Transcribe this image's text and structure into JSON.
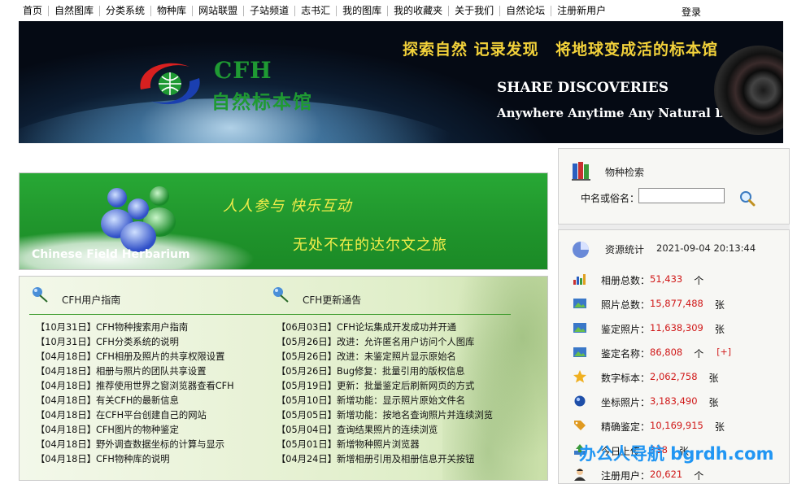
{
  "nav": {
    "items": [
      "首页",
      "自然图库",
      "分类系统",
      "物种库",
      "网站联盟",
      "子站频道",
      "志书汇",
      "我的图库",
      "我的收藏夹",
      "关于我们",
      "自然论坛",
      "注册新用户"
    ],
    "login": "登录"
  },
  "banner": {
    "cfh": "CFH",
    "name": "自然标本馆",
    "slogan1": "探索自然 记录发现",
    "slogan2": "将地球变成活的标本馆",
    "share": "SHARE DISCOVERIES",
    "tagline": "Anywhere Anytime Any Natural Diversity"
  },
  "green_banner": {
    "motto1": "人人参与 快乐互动",
    "motto2": "无处不在的达尔文之旅",
    "site_name": "Chinese Field Herbarium"
  },
  "guide": {
    "title": "CFH用户指南",
    "items": [
      "【10月31日】CFH物种搜索用户指南",
      "【10月31日】CFH分类系统的说明",
      "【04月18日】CFH相册及照片的共享权限设置",
      "【04月18日】相册与照片的团队共享设置",
      "【04月18日】推荐使用世界之窗浏览器查看CFH",
      "【04月18日】有关CFH的最新信息",
      "【04月18日】在CFH平台创建自己的网站",
      "【04月18日】CFH图片的物种鉴定",
      "【04月18日】野外调查数据坐标的计算与显示",
      "【04月18日】CFH物种库的说明"
    ]
  },
  "updates": {
    "title": "CFH更新通告",
    "items": [
      "【06月03日】CFH论坛集成开发成功并开通",
      "【05月26日】改进：允许匿名用户访问个人图库",
      "【05月26日】改进：未鉴定照片显示原始名",
      "【05月26日】Bug修复：批量引用的版权信息",
      "【05月19日】更新：批量鉴定后刷新网页的方式",
      "【05月10日】新增功能：显示照片原始文件名",
      "【05月05日】新增功能：按地名查询照片并连续浏览",
      "【05月04日】查询结果照片的连续浏览",
      "【05月01日】新增物种照片浏览器",
      "【04月24日】新增相册引用及相册信息开关按钮"
    ]
  },
  "search": {
    "title": "物种检索",
    "label": "中名或俗名：",
    "value": "",
    "placeholder": ""
  },
  "stats": {
    "title": "资源统计",
    "time": "2021-09-04 20:13:44",
    "rows": [
      {
        "label": "相册总数：",
        "value": "51,433",
        "unit": "个"
      },
      {
        "label": "照片总数：",
        "value": "15,877,488",
        "unit": "张"
      },
      {
        "label": "鉴定照片：",
        "value": "11,638,309",
        "unit": "张"
      },
      {
        "label": "鉴定名称：",
        "value": "86,808",
        "unit": "个",
        "extra": "[+]"
      },
      {
        "label": "数字标本：",
        "value": "2,062,758",
        "unit": "张"
      },
      {
        "label": "坐标照片：",
        "value": "3,183,490",
        "unit": "张"
      },
      {
        "label": "精确鉴定：",
        "value": "10,169,915",
        "unit": "张"
      },
      {
        "label": "今日上传：",
        "value": "338",
        "unit": "张"
      },
      {
        "label": "注册用户：",
        "value": "20,621",
        "unit": "个"
      }
    ],
    "icons": [
      "bar-chart-icon",
      "photo-icon",
      "photo-check-icon",
      "photo-tag-icon",
      "star-icon",
      "globe-icon",
      "tag-icon",
      "upload-icon",
      "user-icon"
    ]
  },
  "watermark": "办公人导航 bgrdh.com",
  "colors": {
    "accent_green": "#1f9a33",
    "banner_yellow": "#f2d13a",
    "stat_red": "#d01818",
    "watermark_blue": "#2196f3"
  }
}
